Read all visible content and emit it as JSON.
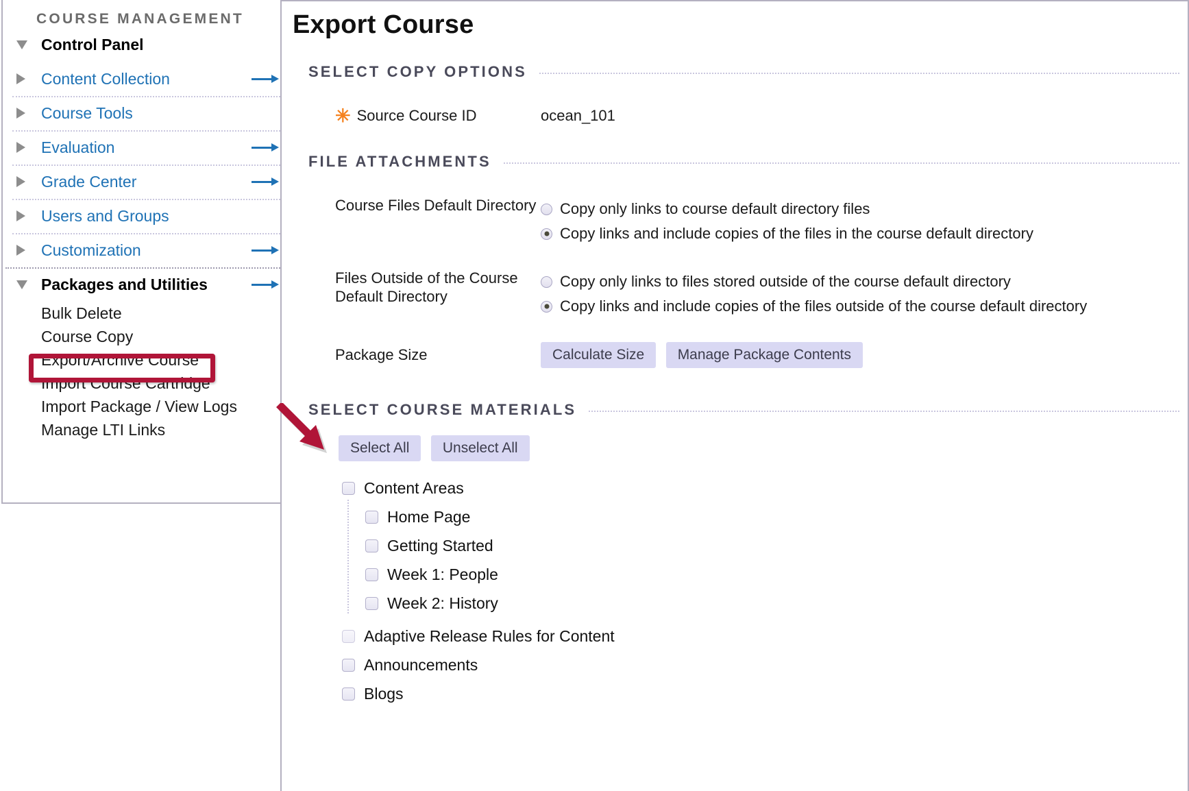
{
  "sidebar": {
    "heading": "COURSE MANAGEMENT",
    "nav": [
      {
        "label": "Control Panel",
        "expanded": true,
        "bold": true,
        "arrow": false
      },
      {
        "label": "Content Collection",
        "expanded": false,
        "bold": false,
        "arrow": true
      },
      {
        "label": "Course Tools",
        "expanded": false,
        "bold": false,
        "arrow": false
      },
      {
        "label": "Evaluation",
        "expanded": false,
        "bold": false,
        "arrow": true
      },
      {
        "label": "Grade Center",
        "expanded": false,
        "bold": false,
        "arrow": true
      },
      {
        "label": "Users and Groups",
        "expanded": false,
        "bold": false,
        "arrow": false
      },
      {
        "label": "Customization",
        "expanded": false,
        "bold": false,
        "arrow": true
      },
      {
        "label": "Packages and Utilities",
        "expanded": true,
        "bold": true,
        "arrow": true
      }
    ],
    "sub_items": [
      {
        "label": "Bulk Delete",
        "highlighted": false
      },
      {
        "label": "Course Copy",
        "highlighted": false
      },
      {
        "label": "Export/Archive Course",
        "highlighted": true
      },
      {
        "label": "Import Course Cartridge",
        "highlighted": false
      },
      {
        "label": "Import Package / View Logs",
        "highlighted": false
      },
      {
        "label": "Manage LTI Links",
        "highlighted": false
      }
    ]
  },
  "main": {
    "title": "Export Course",
    "sections": {
      "copy_options": {
        "heading": "SELECT COPY OPTIONS",
        "source_course_id_label": "Source Course ID",
        "source_course_id_value": "ocean_101",
        "required_marker": "✳"
      },
      "file_attachments": {
        "heading": "FILE ATTACHMENTS",
        "groups": [
          {
            "label": "Course Files Default Directory",
            "options": [
              {
                "text": "Copy only links to course default directory files",
                "selected": false
              },
              {
                "text": "Copy links and include copies of the files in the course default directory",
                "selected": true
              }
            ]
          },
          {
            "label": "Files Outside of the Course Default Directory",
            "options": [
              {
                "text": "Copy only links to files stored outside of the course default directory",
                "selected": false
              },
              {
                "text": "Copy links and include copies of the files outside of the course default directory",
                "selected": true
              }
            ]
          }
        ],
        "package_size_label": "Package Size",
        "calculate_size_button": "Calculate Size",
        "manage_package_button": "Manage Package Contents"
      },
      "course_materials": {
        "heading": "SELECT COURSE MATERIALS",
        "select_all_button": "Select All",
        "unselect_all_button": "Unselect All",
        "tree": [
          {
            "label": "Content Areas",
            "checked": false,
            "faded": false,
            "children": [
              {
                "label": "Home Page",
                "checked": false
              },
              {
                "label": "Getting Started",
                "checked": false
              },
              {
                "label": "Week 1: People",
                "checked": false
              },
              {
                "label": "Week 2: History",
                "checked": false
              }
            ]
          },
          {
            "label": "Adaptive Release Rules for Content",
            "checked": false,
            "faded": true,
            "children": []
          },
          {
            "label": "Announcements",
            "checked": false,
            "faded": false,
            "children": []
          },
          {
            "label": "Blogs",
            "checked": false,
            "faded": false,
            "children": []
          }
        ]
      }
    }
  },
  "annotations": {
    "highlight_target": "Export/Archive Course",
    "arrow_target": "Select All",
    "highlight_color": "#b01538",
    "arrow_color": "#b01538"
  }
}
